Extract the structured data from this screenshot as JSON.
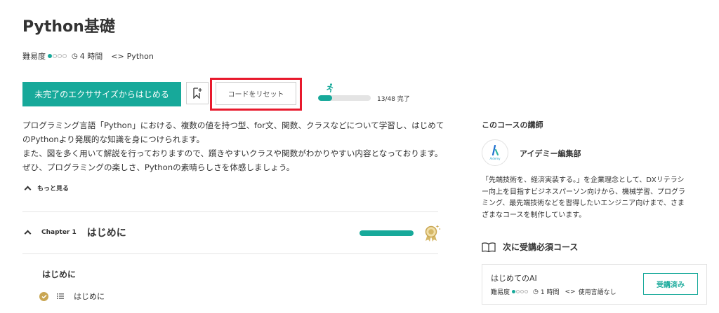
{
  "course": {
    "title": "Python基礎",
    "difficulty_label": "難易度",
    "difficulty_level": 1,
    "difficulty_max": 4,
    "duration": "4 時間",
    "language": "Python"
  },
  "actions": {
    "start_label": "未完了のエクササイズからはじめる",
    "reset_label": "コードをリセット",
    "bookmark_icon": "bookmark-add-icon"
  },
  "progress": {
    "completed": 13,
    "total": 48,
    "text": "13/48 完了",
    "icon": "runner-icon"
  },
  "description": {
    "lines": [
      "プログラミング言語「Python」における、複数の値を持つ型、for文、関数、クラスなどについて学習し、はじめて",
      "のPythonより発展的な知識を身につけられます。",
      "また、図を多く用いて解説を行っておりますので、躓きやすいクラスや関数がわかりやすい内容となっております。",
      "ぜひ、プログラミングの楽しさ、Pythonの素晴らしさを体感しましょう。"
    ],
    "more_label": "もっと見る"
  },
  "chapter": {
    "number": "Chapter 1",
    "title": "はじめに",
    "progress": 1.0,
    "medal_icon": "medal-icon",
    "section_title": "はじめに",
    "lesson_title": "はじめに"
  },
  "instructor": {
    "heading": "このコースの講師",
    "name": "アイデミー編集部",
    "brand": "Aidemy",
    "bio": [
      "「先端技術を、経済実装する。」を企業理念として、DXリテラシ",
      "ー向上を目指すビジネスパーソン向けから、機械学習、プログラ",
      "ミング、最先端技術などを習得したいエンジニア向けまで、さま",
      "ざまなコースを制作しています。"
    ]
  },
  "next_course": {
    "heading": "次に受講必須コース",
    "title": "はじめてのAI",
    "difficulty_label": "難易度",
    "difficulty_level": 1,
    "difficulty_max": 4,
    "duration": "1 時間",
    "language": "使用言語なし",
    "button_label": "受講済み"
  },
  "colors": {
    "accent": "#17a99a",
    "highlight": "#e8192c",
    "gold": "#c9a653"
  }
}
